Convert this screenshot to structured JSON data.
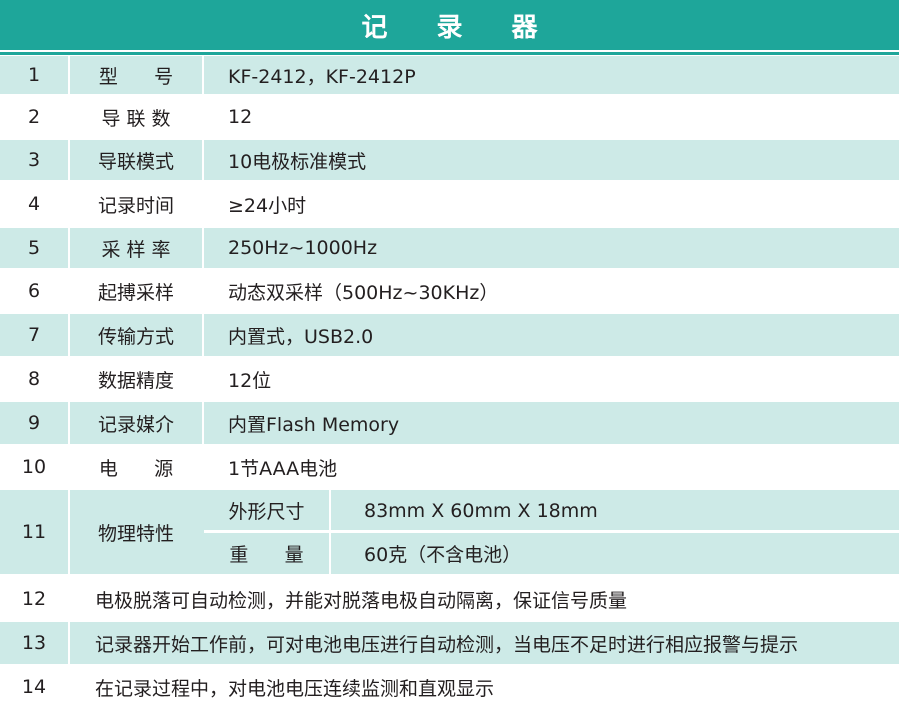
{
  "title": "记 录 器",
  "rows": [
    {
      "num": "1",
      "name": "型      号",
      "value": "KF-2412，KF-2412P"
    },
    {
      "num": "2",
      "name": "导 联 数",
      "value": "12"
    },
    {
      "num": "3",
      "name": "导联模式",
      "value": "10电极标准模式"
    },
    {
      "num": "4",
      "name": "记录时间",
      "value": "≥24小时"
    },
    {
      "num": "5",
      "name": "采 样 率",
      "value": "250Hz~1000Hz"
    },
    {
      "num": "6",
      "name": "起搏采样",
      "value": "动态双采样（500Hz~30KHz）"
    },
    {
      "num": "7",
      "name": "传输方式",
      "value": "内置式，USB2.0"
    },
    {
      "num": "8",
      "name": "数据精度",
      "value": "12位"
    },
    {
      "num": "9",
      "name": "记录媒介",
      "value": "内置Flash Memory"
    },
    {
      "num": "10",
      "name": "电      源",
      "value": "1节AAA电池"
    }
  ],
  "row11": {
    "num": "11",
    "name": "物理特性",
    "sub": [
      {
        "key": "外形尺寸",
        "value": "83mm X 60mm X 18mm"
      },
      {
        "key": "重      量",
        "value": "60克（不含电池）"
      }
    ]
  },
  "notes": [
    {
      "num": "12",
      "text": "电极脱落可自动检测，并能对脱落电极自动隔离，保证信号质量"
    },
    {
      "num": "13",
      "text": "记录器开始工作前，可对电池电压进行自动检测，当电压不足时进行相应报警与提示"
    },
    {
      "num": "14",
      "text": "在记录过程中，对电池电压连续监测和直观显示"
    }
  ]
}
